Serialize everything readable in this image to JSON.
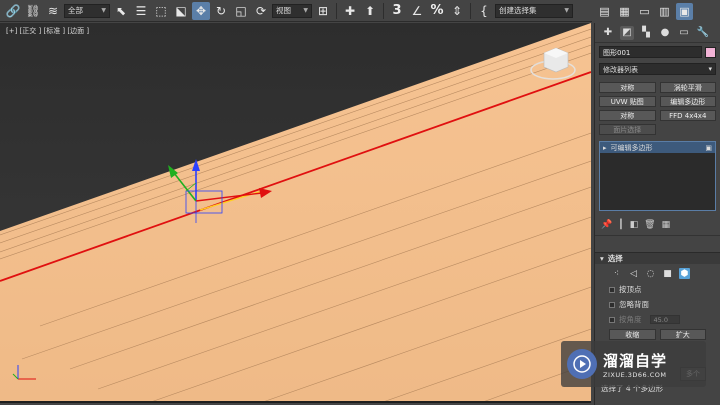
{
  "toolbar": {
    "filter_dropdown": "全部",
    "refcoord_dropdown": "视图",
    "snap_number": "3",
    "percent_symbol": "%",
    "named_selection": "创建选择集",
    "icons": [
      "link-icon",
      "unlink-icon",
      "bind-spacewarp-icon",
      "select-object-icon",
      "select-by-name-icon",
      "rect-selection-region-icon",
      "window-crossing-icon",
      "move-icon",
      "rotate-icon",
      "scale-icon",
      "pivot-icon",
      "manipulate-icon",
      "keyboard-shortcut-icon",
      "snap-toggle-icon",
      "angle-snap-icon",
      "percent-snap-icon",
      "spinner-snap-icon",
      "edit-named-sets-icon",
      "mirror-icon",
      "align-icon"
    ]
  },
  "right_top": {
    "icons": [
      "scene-explorer-icon",
      "layer-explorer-icon",
      "ribbon-toggle-icon",
      "curve-editor-icon",
      "schematic-view-icon"
    ]
  },
  "viewport": {
    "label": "[+] [正交 ] [标准 ] [边面 ]",
    "background_color": "#333333",
    "surface_color": "#f2bd8b",
    "selected_edge_color": "#e01010"
  },
  "command_panel": {
    "tabs": [
      "create-tab",
      "modify-tab",
      "hierarchy-tab",
      "motion-tab",
      "display-tab",
      "utilities-tab"
    ],
    "object_name": "图形001",
    "object_color": "#f2b3d6",
    "modifier_list": "修改器列表",
    "modifier_buttons": [
      "对称",
      "涡轮平滑",
      "UVW 贴图",
      "编辑多边形",
      "对称",
      "FFD 4x4x4"
    ],
    "modifier_button_disabled": "面片选择",
    "stack_item": "可编辑多边形",
    "selection_rollout": {
      "title": "选择",
      "by_vertex": "按顶点",
      "ignore_backfacing": "忽略背面",
      "by_angle": "按角度",
      "angle_value": "45.0",
      "shrink": "收缩",
      "grow": "扩大",
      "many_label": "多个",
      "bottom_text": "选择了 4 个多边形"
    }
  },
  "watermark": {
    "title": "溜溜自学",
    "url": "ZIXUE.3D66.COM"
  }
}
